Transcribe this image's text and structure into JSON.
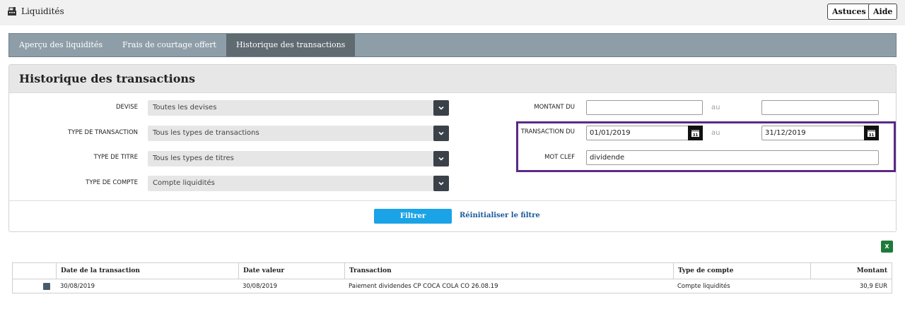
{
  "app": {
    "title": "Liquidités",
    "icon": "cash-register-icon",
    "buttons": {
      "tips": "Astuces",
      "help": "Aide"
    }
  },
  "tabs": [
    {
      "label": "Aperçu des liquidités",
      "active": false
    },
    {
      "label": "Frais de courtage offert",
      "active": false
    },
    {
      "label": "Historique des transactions",
      "active": true
    }
  ],
  "filter": {
    "title": "Historique des transactions",
    "devise": {
      "label": "DEVISE",
      "value": "Toutes les devises"
    },
    "type_transaction": {
      "label": "TYPE DE TRANSACTION",
      "value": "Tous les types de transactions"
    },
    "type_titre": {
      "label": "TYPE DE TITRE",
      "value": "Tous les types de titres"
    },
    "type_compte": {
      "label": "TYPE DE COMPTE",
      "value": "Compte liquidités"
    },
    "montant": {
      "label": "MONTANT DU",
      "from": "",
      "au": "au",
      "to": ""
    },
    "transaction_du": {
      "label": "TRANSACTION DU",
      "from": "01/01/2019",
      "au": "au",
      "to": "31/12/2019",
      "calendar_glyph": "31"
    },
    "mot_clef": {
      "label": "MOT CLEF",
      "value": "dividende"
    },
    "filter_button": "Filtrer",
    "reset_link": "Réinitialiser le filtre",
    "highlight_color": "#5a2a86",
    "accent_color": "#1aa3e6"
  },
  "export": {
    "icon": "excel-export-icon",
    "glyph": "X"
  },
  "table": {
    "headers": [
      "",
      "Date de la transaction",
      "Date valeur",
      "Transaction",
      "Type de compte",
      "Montant"
    ],
    "rows": [
      {
        "icon": "info-icon",
        "date_transaction": "30/08/2019",
        "date_valeur": "30/08/2019",
        "transaction": "Paiement dividendes CP COCA COLA CO 26.08.19",
        "type_compte": "Compte liquidités",
        "montant": "30,9 EUR"
      }
    ]
  }
}
